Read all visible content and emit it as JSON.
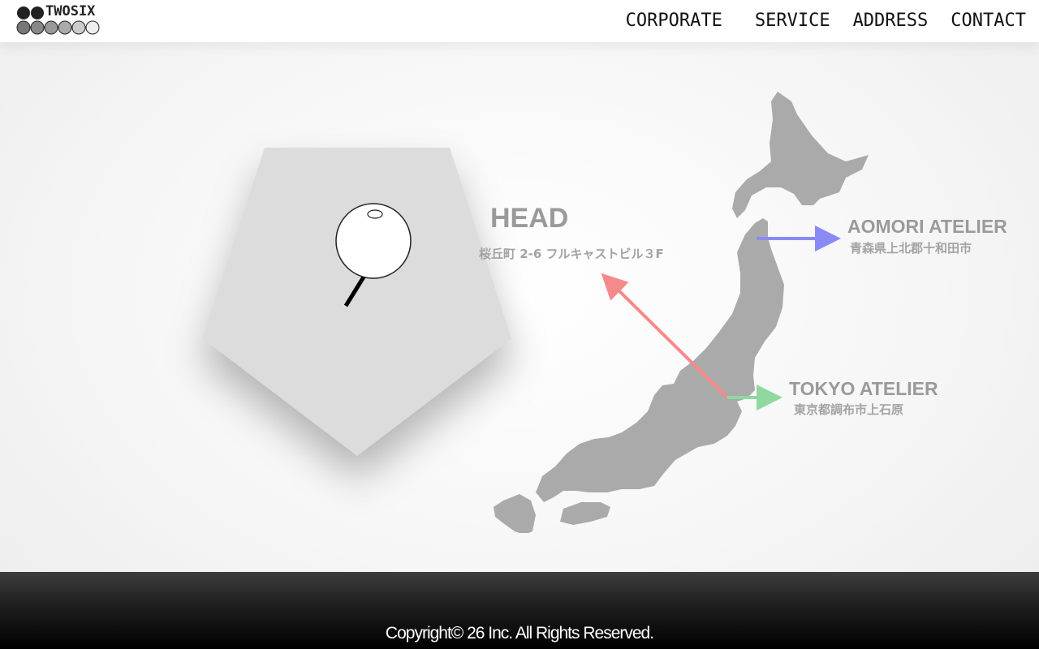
{
  "brand": {
    "logo_text": "TWOSIX",
    "logo_icon": "circles-logo-icon"
  },
  "nav": {
    "items": [
      {
        "label": "CORPORATE"
      },
      {
        "label": "SERVICE"
      },
      {
        "label": "ADDRESS"
      },
      {
        "label": "CONTACT"
      }
    ]
  },
  "locations": {
    "head": {
      "title": "HEAD",
      "address": "桜丘町 2-6 フルキャストビル３F",
      "arrow_color": "#f58a8a"
    },
    "aomori": {
      "title": "AOMORI ATELIER",
      "address": "青森県上北郡十和田市",
      "arrow_color": "#8a8af5"
    },
    "tokyo": {
      "title": "TOKYO ATELIER",
      "address": "東京都調布市上石原",
      "arrow_color": "#8fd9a0"
    }
  },
  "icons": {
    "pin": "map-pin-icon",
    "map": "japan-map-icon"
  },
  "colors": {
    "map_fill": "#aaaaaa",
    "pentagon": "#dcdcdc",
    "footer": "#000000"
  },
  "footer": {
    "copyright": "Copyright© 26 Inc. All Rights Reserved."
  }
}
